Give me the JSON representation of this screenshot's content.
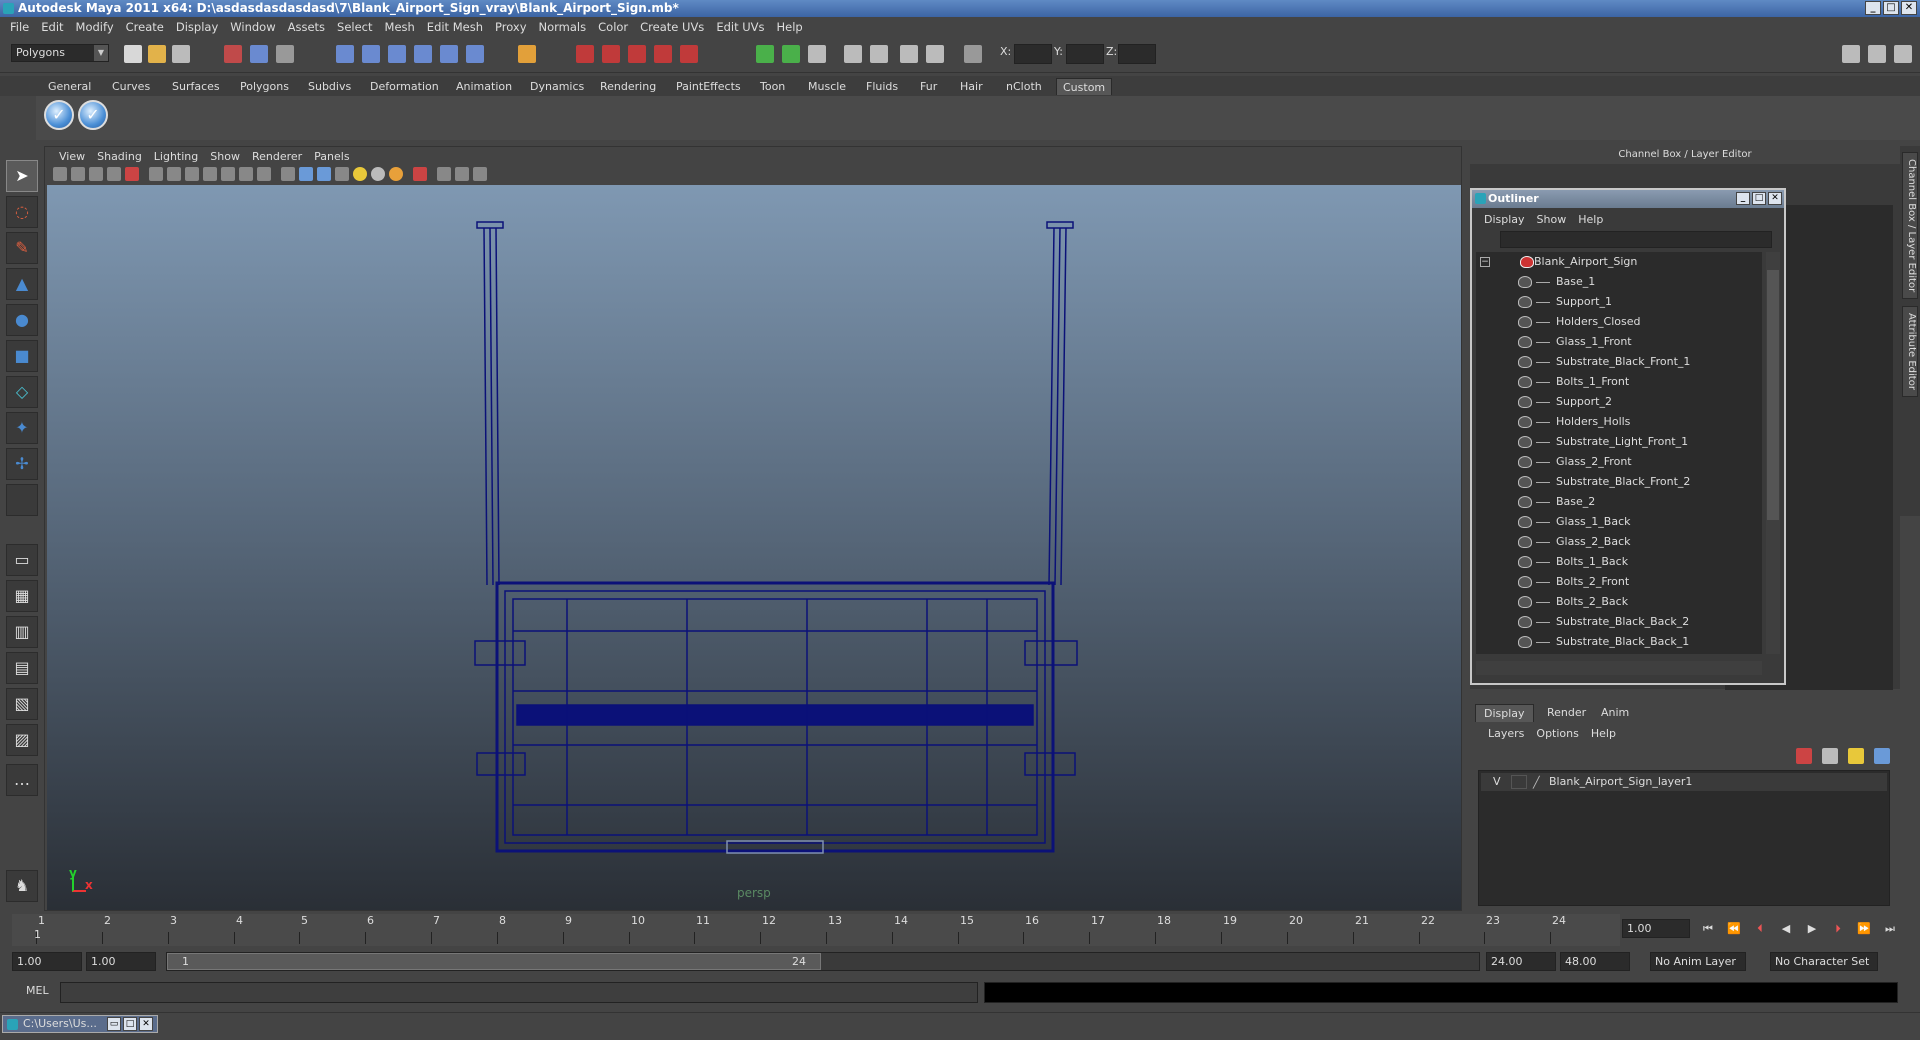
{
  "window": {
    "title": "Autodesk Maya 2011 x64: D:\\asdasdasdasdasd\\7\\Blank_Airport_Sign_vray\\Blank_Airport_Sign.mb*",
    "min": "_",
    "max": "□",
    "close": "✕"
  },
  "menubar": [
    "File",
    "Edit",
    "Modify",
    "Create",
    "Display",
    "Window",
    "Assets",
    "Select",
    "Mesh",
    "Edit Mesh",
    "Proxy",
    "Normals",
    "Color",
    "Create UVs",
    "Edit UVs",
    "Help"
  ],
  "status": {
    "mode": "Polygons",
    "x_label": "X:",
    "y_label": "Y:",
    "z_label": "Z:"
  },
  "shelf": {
    "tabs": [
      "General",
      "Curves",
      "Surfaces",
      "Polygons",
      "Subdivs",
      "Deformation",
      "Animation",
      "Dynamics",
      "Rendering",
      "PaintEffects",
      "Toon",
      "Muscle",
      "Fluids",
      "Fur",
      "Hair",
      "nCloth",
      "Custom"
    ],
    "active_tab": "Custom"
  },
  "viewport": {
    "menu": [
      "View",
      "Shading",
      "Lighting",
      "Show",
      "Renderer",
      "Panels"
    ],
    "camera_label": "persp",
    "axis_y": "y",
    "axis_x": "x",
    "wire_color": "#0b1178"
  },
  "channel_box": {
    "title": "Channel Box / Layer Editor",
    "side_tabs": [
      "Channel Box / Layer Editor",
      "Attribute Editor"
    ]
  },
  "outliner": {
    "title": "Outliner",
    "menu": [
      "Display",
      "Show",
      "Help"
    ],
    "root": "Blank_Airport_Sign",
    "items": [
      "Base_1",
      "Support_1",
      "Holders_Closed",
      "Glass_1_Front",
      "Substrate_Black_Front_1",
      "Bolts_1_Front",
      "Support_2",
      "Holders_Holls",
      "Substrate_Light_Front_1",
      "Glass_2_Front",
      "Substrate_Black_Front_2",
      "Base_2",
      "Glass_1_Back",
      "Glass_2_Back",
      "Bolts_1_Back",
      "Bolts_2_Front",
      "Bolts_2_Back",
      "Substrate_Black_Back_2",
      "Substrate_Black_Back_1"
    ]
  },
  "layers": {
    "tabs": [
      "Display",
      "Render",
      "Anim"
    ],
    "active_tab": "Display",
    "menu": [
      "Layers",
      "Options",
      "Help"
    ],
    "visible_flag": "V",
    "layer_name": "Blank_Airport_Sign_layer1"
  },
  "timeline": {
    "ticks": [
      "1",
      "2",
      "3",
      "4",
      "5",
      "6",
      "7",
      "8",
      "9",
      "10",
      "11",
      "12",
      "13",
      "14",
      "15",
      "16",
      "17",
      "18",
      "19",
      "20",
      "21",
      "22",
      "23",
      "24"
    ],
    "current": "1.00",
    "current_tick": "1"
  },
  "range": {
    "start": "1.00",
    "start2": "1.00",
    "slider_start": "1",
    "slider_end": "24",
    "end": "24.00",
    "end2": "48.00",
    "anim_layer": "No Anim Layer",
    "char_set": "No Character Set"
  },
  "command": {
    "label": "MEL"
  },
  "taskbar": {
    "task": "C:\\Users\\Us..."
  }
}
